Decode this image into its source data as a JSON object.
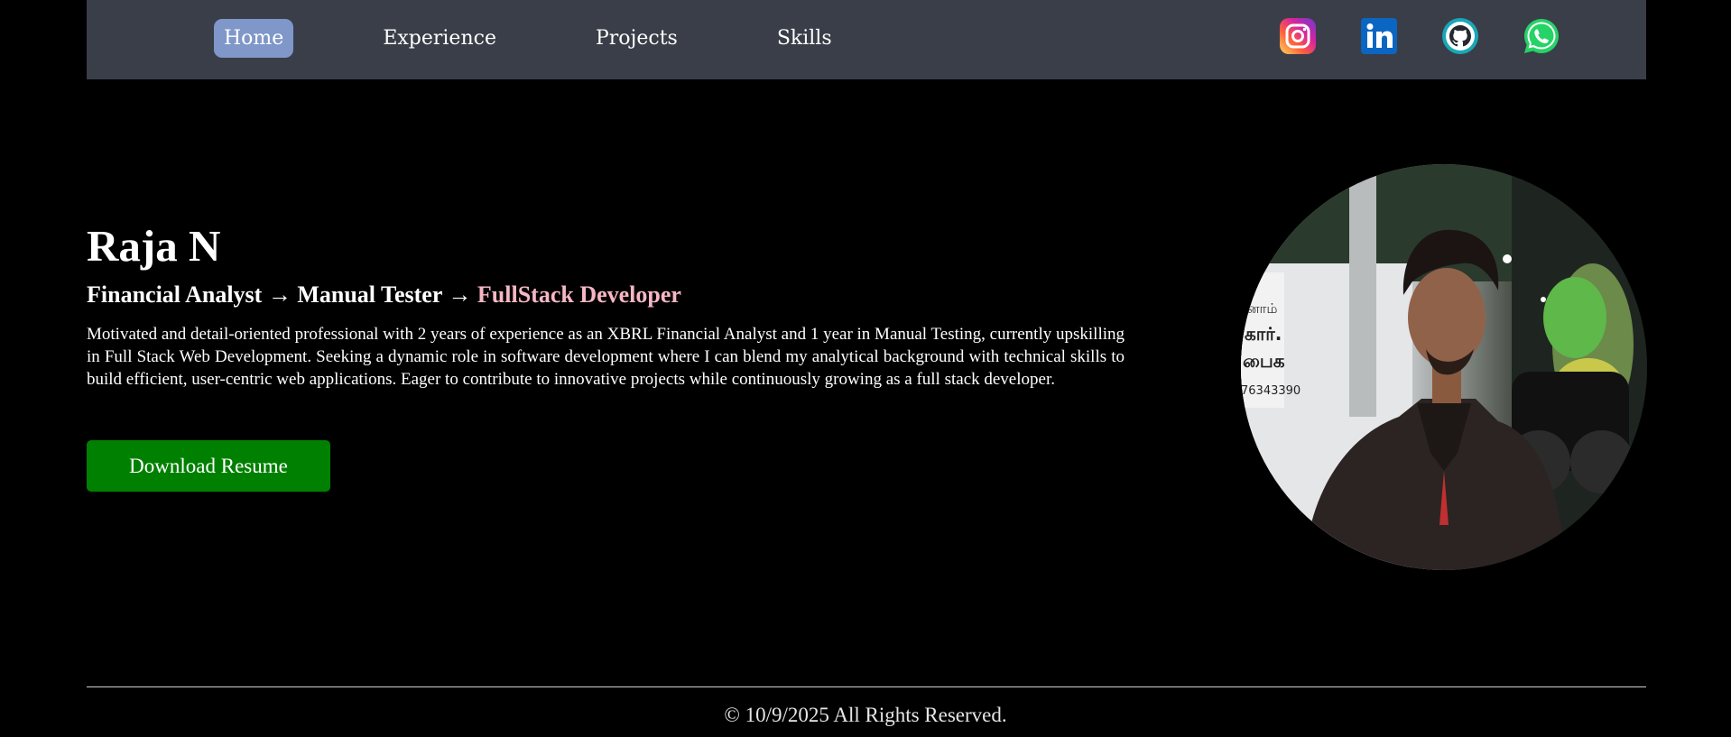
{
  "nav": {
    "links": [
      {
        "label": "Home",
        "active": true
      },
      {
        "label": "Experience",
        "active": false
      },
      {
        "label": "Projects",
        "active": false
      },
      {
        "label": "Skills",
        "active": false
      }
    ],
    "socials": [
      {
        "name": "instagram-icon"
      },
      {
        "name": "linkedin-icon"
      },
      {
        "name": "github-icon"
      },
      {
        "name": "whatsapp-icon"
      }
    ]
  },
  "hero": {
    "name": "Raja N",
    "role_prefix": "Financial Analyst → Manual Tester → ",
    "role_highlight": "FullStack Developer",
    "description": "Motivated and detail-oriented professional with 2 years of experience as an XBRL Financial Analyst and 1 year in Manual Testing, currently upskilling in Full Stack Web Development. Seeking a dynamic role in software development where I can blend my analytical background with technical skills to build efficient, user-centric web applications. Eager to contribute to innovative projects while continuously growing as a full stack developer.",
    "download_label": "Download Resume"
  },
  "footer": {
    "copyright": "© 10/9/2025 All Rights Reserved."
  },
  "colors": {
    "background": "#000000",
    "navbar": "#3a3e48",
    "nav_active": "#7f97c9",
    "accent": "#f6b7c4",
    "button": "#008000"
  }
}
